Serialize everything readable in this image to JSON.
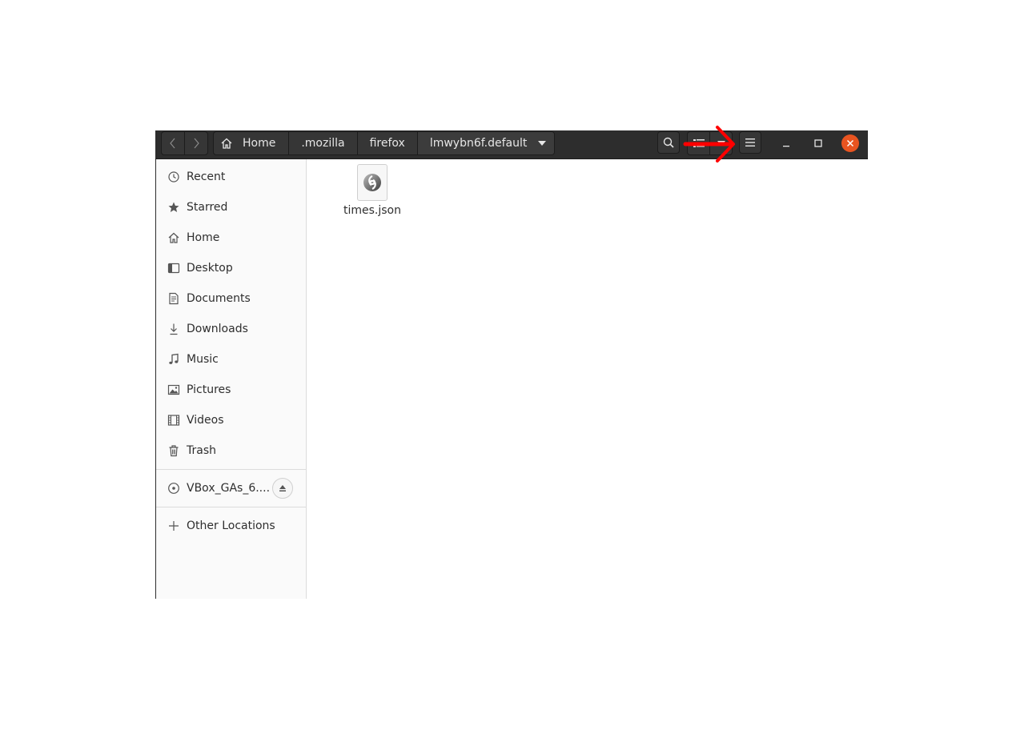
{
  "window": {
    "nav": {
      "back_icon": "chevron-left-icon",
      "forward_icon": "chevron-right-icon"
    },
    "breadcrumb": [
      {
        "label": "Home",
        "icon": "home-icon"
      },
      {
        "label": ".mozilla"
      },
      {
        "label": "firefox"
      },
      {
        "label": "lmwybn6f.default",
        "icon": "dropdown-arrow-icon"
      }
    ],
    "toolbar": {
      "search_icon": "search-icon",
      "view_list_icon": "view-list-icon",
      "view_options_icon": "view-options-icon",
      "menu_icon": "hamburger-menu-icon"
    },
    "controls": {
      "minimize_icon": "minimize-icon",
      "maximize_icon": "maximize-icon",
      "close_icon": "close-icon",
      "close_color": "#e95420"
    }
  },
  "sidebar": {
    "places": [
      {
        "label": "Recent",
        "icon": "clock-icon"
      },
      {
        "label": "Starred",
        "icon": "star-icon"
      },
      {
        "label": "Home",
        "icon": "home-icon"
      },
      {
        "label": "Desktop",
        "icon": "desktop-icon"
      },
      {
        "label": "Documents",
        "icon": "document-icon"
      },
      {
        "label": "Downloads",
        "icon": "download-icon"
      },
      {
        "label": "Music",
        "icon": "music-icon"
      },
      {
        "label": "Pictures",
        "icon": "picture-icon"
      },
      {
        "label": "Videos",
        "icon": "video-icon"
      },
      {
        "label": "Trash",
        "icon": "trash-icon"
      }
    ],
    "devices": [
      {
        "label": "VBox_GAs_6....",
        "icon": "disc-icon",
        "action_icon": "eject-icon"
      }
    ],
    "other": {
      "label": "Other Locations",
      "icon": "plus-icon"
    }
  },
  "content": {
    "files": [
      {
        "name": "times.json",
        "icon": "json-file-icon"
      }
    ]
  },
  "annotation": {
    "icon": "red-arrow-icon",
    "color": "#ff0000"
  }
}
